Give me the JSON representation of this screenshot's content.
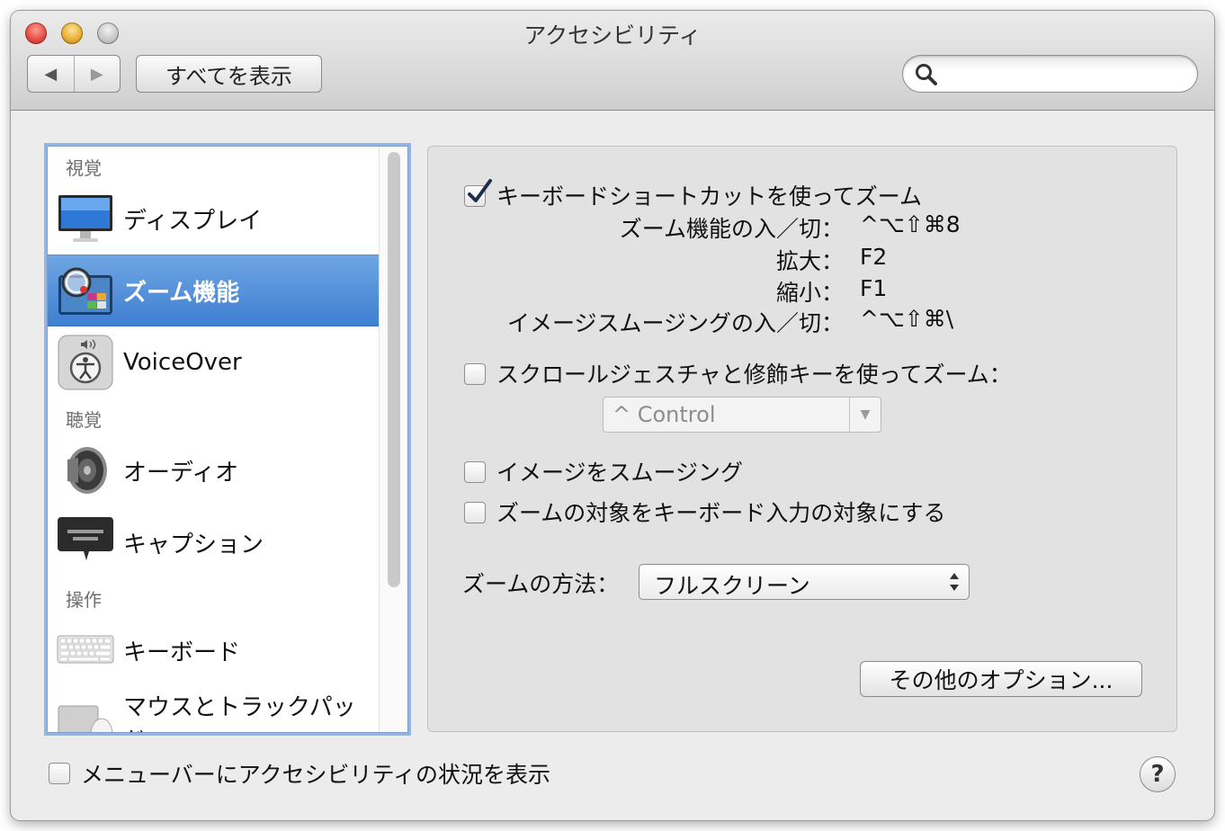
{
  "window": {
    "title": "アクセシビリティ"
  },
  "toolbar": {
    "back_glyph": "◀",
    "forward_glyph": "▶",
    "show_all_label": "すべてを表示",
    "search_placeholder": "",
    "search_value": ""
  },
  "sidebar": {
    "sections": [
      {
        "label": "視覚",
        "items": [
          {
            "label": "ディスプレイ",
            "icon": "display-icon"
          },
          {
            "label": "ズーム機能",
            "icon": "zoom-icon",
            "selected": true
          },
          {
            "label": "VoiceOver",
            "icon": "voiceover-icon"
          }
        ]
      },
      {
        "label": "聴覚",
        "items": [
          {
            "label": "オーディオ",
            "icon": "speaker-icon"
          },
          {
            "label": "キャプション",
            "icon": "caption-icon"
          }
        ]
      },
      {
        "label": "操作",
        "items": [
          {
            "label": "キーボード",
            "icon": "keyboard-icon"
          },
          {
            "label": "マウスとトラックパッド",
            "icon": "mouse-icon"
          }
        ]
      }
    ]
  },
  "zoom": {
    "keyboard_shortcuts": {
      "label": "キーボードショートカットを使ってズーム",
      "checked": true,
      "shortcuts": [
        {
          "name": "ズーム機能の入／切：",
          "keys": "^⌥⇧⌘8"
        },
        {
          "name": "拡大：",
          "keys": "F2"
        },
        {
          "name": "縮小：",
          "keys": "F1"
        },
        {
          "name": "イメージスムージングの入／切：",
          "keys": "^⌥⇧⌘\\"
        }
      ]
    },
    "scroll_gesture": {
      "label": "スクロールジェスチャと修飾キーを使ってズーム：",
      "checked": false,
      "modifier_value": "^ Control"
    },
    "smooth_images": {
      "label": "イメージをスムージング",
      "checked": false
    },
    "follow_keyboard": {
      "label": "ズームの対象をキーボード入力の対象にする",
      "checked": false
    },
    "style": {
      "label": "ズームの方法：",
      "value": "フルスクリーン"
    },
    "more_options_label": "その他のオプション..."
  },
  "footer": {
    "show_in_menubar_label": "メニューバーにアクセシビリティの状況を表示",
    "show_in_menubar_checked": false,
    "help_label": "?"
  },
  "colors": {
    "selection": "#3f7fd2",
    "focus_ring": "#91b7ea",
    "window_bg": "#ececec",
    "panel_bg": "#e2e2e2"
  }
}
